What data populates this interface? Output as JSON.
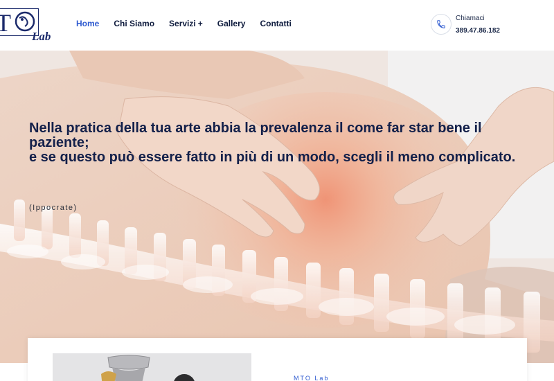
{
  "brand": {
    "logo_text": "MTO",
    "logo_sub": "Lab"
  },
  "nav": {
    "items": [
      {
        "label": "Home",
        "active": true
      },
      {
        "label": "Chi Siamo",
        "active": false
      },
      {
        "label": "Servizi",
        "active": false,
        "has_submenu": true,
        "submenu_indicator": "+"
      },
      {
        "label": "Gallery",
        "active": false
      },
      {
        "label": "Contatti",
        "active": false
      }
    ]
  },
  "call": {
    "label": "Chiamaci",
    "number": "389.47.86.182",
    "icon": "phone-icon"
  },
  "hero": {
    "quote_line1": "Nella pratica della tua arte abbia la prevalenza il come far star bene il paziente;",
    "quote_line2": "e se questo può essere fatto in più di un modo, scegli il meno complicato.",
    "author": "(Ippocrate)"
  },
  "card": {
    "label": "MTO Lab"
  },
  "colors": {
    "accent": "#2f5bd0",
    "navy": "#13204a",
    "nav_text": "#0e1b3d"
  }
}
